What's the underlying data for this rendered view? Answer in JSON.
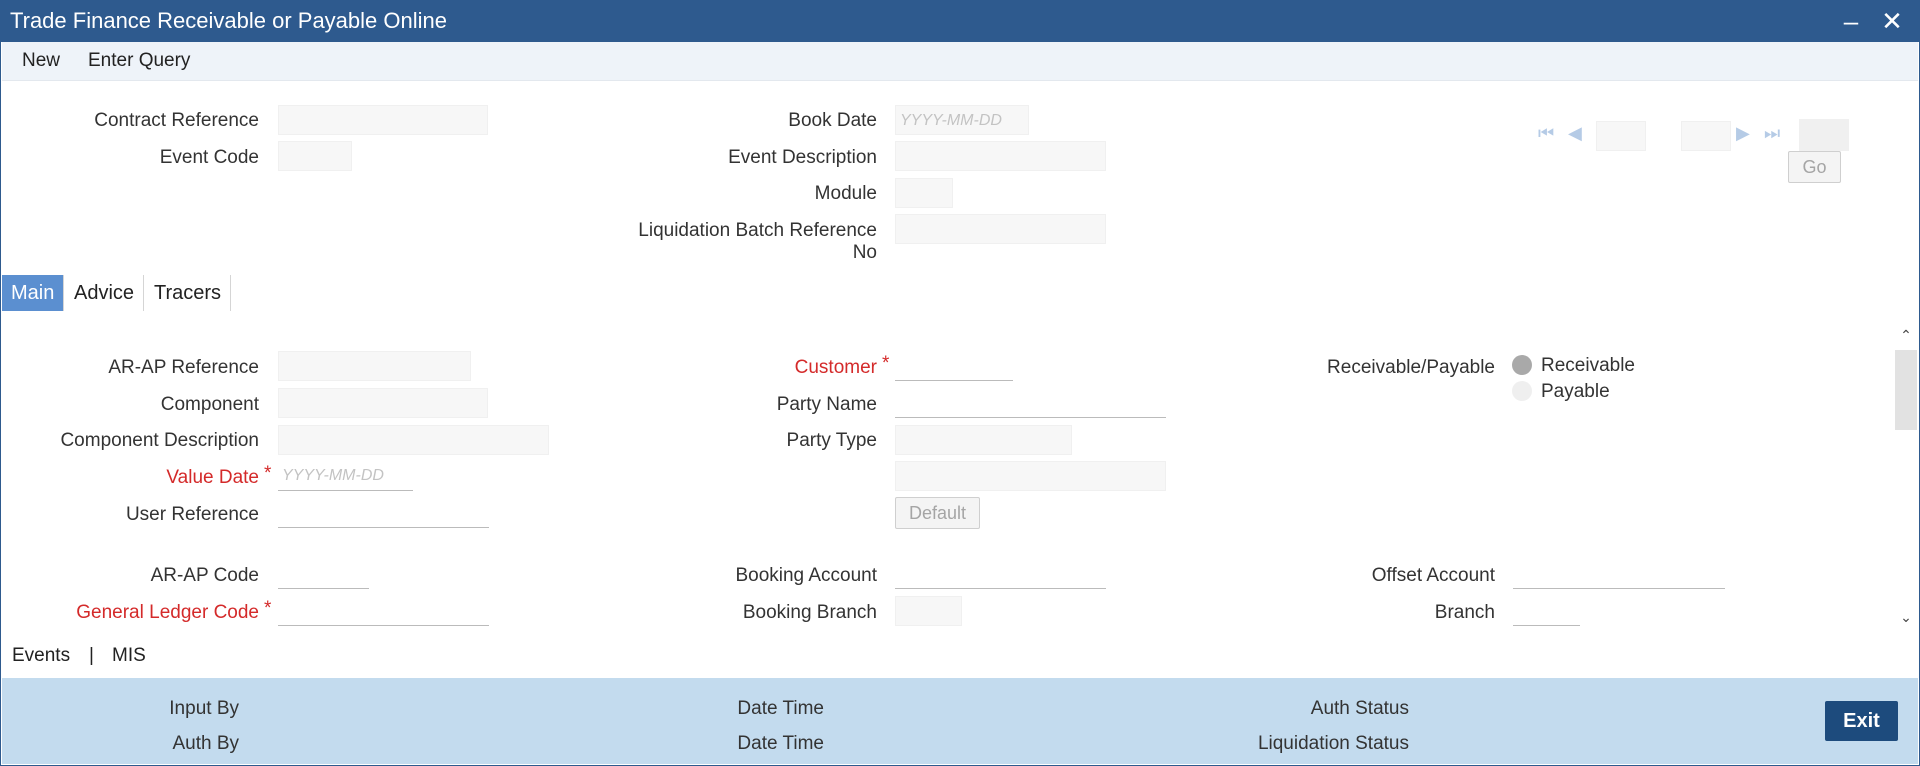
{
  "window": {
    "title": "Trade Finance Receivable or Payable Online"
  },
  "menu": {
    "new": "New",
    "enter_query": "Enter Query"
  },
  "header": {
    "contract_reference": "Contract Reference",
    "event_code": "Event Code",
    "book_date": "Book Date",
    "book_date_placeholder": "YYYY-MM-DD",
    "event_description": "Event Description",
    "module": "Module",
    "liquidation_batch_reference_1": "Liquidation Batch Reference",
    "liquidation_batch_reference_2": "No",
    "go": "Go"
  },
  "tabs": [
    "Main",
    "Advice",
    "Tracers"
  ],
  "main": {
    "ar_ap_reference": "AR-AP Reference",
    "component": "Component",
    "component_description": "Component Description",
    "value_date": "Value Date",
    "value_date_placeholder": "YYYY-MM-DD",
    "user_reference": "User Reference",
    "customer": "Customer",
    "party_name": "Party Name",
    "party_type": "Party Type",
    "default": "Default",
    "receivable_payable": "Receivable/Payable",
    "receivable": "Receivable",
    "payable": "Payable",
    "ar_ap_code": "AR-AP Code",
    "general_ledger_code": "General Ledger Code",
    "booking_account": "Booking Account",
    "booking_branch": "Booking Branch",
    "offset_account": "Offset Account",
    "branch": "Branch",
    "required_mark": "*"
  },
  "footer_links": {
    "events": "Events",
    "separator": "|",
    "mis": "MIS"
  },
  "audit": {
    "input_by": "Input By",
    "auth_by": "Auth By",
    "date_time_1": "Date Time",
    "date_time_2": "Date Time",
    "auth_status": "Auth Status",
    "liquidation_status": "Liquidation Status",
    "exit": "Exit"
  },
  "colors": {
    "title_bar": "#2e5a8e",
    "active_tab": "#5b8fd0",
    "required": "#d42a2a",
    "audit_bg": "#c3dbee",
    "exit_btn": "#1d4b7d"
  }
}
